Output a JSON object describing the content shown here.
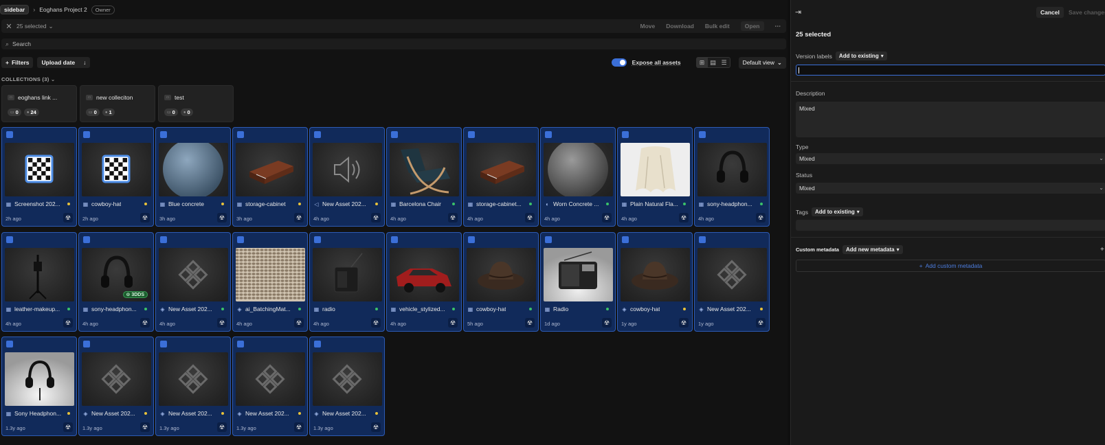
{
  "breadcrumb": {
    "sidebar_label": "sidebar",
    "project": "Eoghans Project 2",
    "role": "Owner"
  },
  "selection_bar": {
    "count": "25 selected",
    "actions": [
      "Move",
      "Download",
      "Bulk edit",
      "Open"
    ]
  },
  "search": {
    "placeholder": "Search"
  },
  "toolbar": {
    "filters": "Filters",
    "sort": "Upload date",
    "expose": "Expose all assets",
    "view": "Default view"
  },
  "collections": {
    "label": "COLLECTIONS (3)",
    "items": [
      {
        "name": "eoghans link ...",
        "a": "0",
        "b": "24"
      },
      {
        "name": "new colleciton",
        "a": "0",
        "b": "1"
      },
      {
        "name": "test",
        "a": "0",
        "b": "0"
      }
    ]
  },
  "assets": [
    {
      "name": "Screenshot 202...",
      "time": "2h ago",
      "dot": "#e8c23a",
      "thumb": "checker",
      "icon": "grid"
    },
    {
      "name": "cowboy-hat",
      "time": "2h ago",
      "dot": "#e8c23a",
      "thumb": "checker",
      "icon": "grid"
    },
    {
      "name": "Blue concrete",
      "time": "3h ago",
      "dot": "#e8c23a",
      "thumb": "sphere-blue",
      "icon": "grid"
    },
    {
      "name": "storage-cabinet",
      "time": "3h ago",
      "dot": "#e8c23a",
      "thumb": "cabinet",
      "icon": "grid"
    },
    {
      "name": "New Asset 202...",
      "time": "4h ago",
      "dot": "#e8c23a",
      "thumb": "speaker",
      "icon": "speaker"
    },
    {
      "name": "Barcelona Chair",
      "time": "4h ago",
      "dot": "#3ac26a",
      "thumb": "chair",
      "icon": "table"
    },
    {
      "name": "storage-cabinet...",
      "time": "4h ago",
      "dot": "#3ac26a",
      "thumb": "cabinet",
      "icon": "table"
    },
    {
      "name": "Worn Concrete ...",
      "time": "4h ago",
      "dot": "#3ac26a",
      "thumb": "sphere-grey",
      "icon": "globe"
    },
    {
      "name": "Plain Natural Fla...",
      "time": "4h ago",
      "dot": "#3ac26a",
      "thumb": "cloth",
      "icon": "grid"
    },
    {
      "name": "sony-headphon...",
      "time": "4h ago",
      "dot": "#3ac26a",
      "thumb": "headphones",
      "icon": "table"
    },
    {
      "name": "leather-makeup...",
      "time": "4h ago",
      "dot": "#3ac26a",
      "thumb": "stand",
      "icon": "table"
    },
    {
      "name": "sony-headphon...",
      "time": "4h ago",
      "dot": "#3ac26a",
      "thumb": "headphones",
      "icon": "table",
      "tag": "3DDS"
    },
    {
      "name": "New Asset 202...",
      "time": "4h ago",
      "dot": "#3ac26a",
      "thumb": "diamond",
      "icon": "diamond"
    },
    {
      "name": "ai_BatchingMat...",
      "time": "4h ago",
      "dot": "#3ac26a",
      "thumb": "fabric",
      "icon": "diamond"
    },
    {
      "name": "radio",
      "time": "4h ago",
      "dot": "#3ac26a",
      "thumb": "radio-dark",
      "icon": "table"
    },
    {
      "name": "vehicle_stylized...",
      "time": "4h ago",
      "dot": "#3ac26a",
      "thumb": "car",
      "icon": "table"
    },
    {
      "name": "cowboy-hat",
      "time": "5h ago",
      "dot": "#3ac26a",
      "thumb": "hat",
      "icon": "table"
    },
    {
      "name": "Radio",
      "time": "1d ago",
      "dot": "#3ac26a",
      "thumb": "radio-light",
      "icon": "table"
    },
    {
      "name": "cowboy-hat",
      "time": "1y ago",
      "dot": "#e8c23a",
      "thumb": "hat",
      "icon": "diamond"
    },
    {
      "name": "New Asset 202...",
      "time": "1y ago",
      "dot": "#e8c23a",
      "thumb": "diamond",
      "icon": "diamond"
    },
    {
      "name": "Sony Headphon...",
      "time": "1.3y ago",
      "dot": "#e8c23a",
      "thumb": "headphones-light",
      "icon": "table"
    },
    {
      "name": "New Asset 202...",
      "time": "1.3y ago",
      "dot": "#e8c23a",
      "thumb": "diamond",
      "icon": "diamond"
    },
    {
      "name": "New Asset 202...",
      "time": "1.3y ago",
      "dot": "#e8c23a",
      "thumb": "diamond",
      "icon": "diamond"
    },
    {
      "name": "New Asset 202...",
      "time": "1.3y ago",
      "dot": "#e8c23a",
      "thumb": "diamond",
      "icon": "diamond"
    },
    {
      "name": "New Asset 202...",
      "time": "1.3y ago",
      "dot": "#e8c23a",
      "thumb": "diamond",
      "icon": "diamond"
    }
  ],
  "panel": {
    "cancel": "Cancel",
    "save": "Save changes",
    "title": "25 selected",
    "version_labels": "Version labels",
    "version_mode": "Add to existing",
    "description_label": "Description",
    "description_value": "Mixed",
    "type_label": "Type",
    "type_value": "Mixed",
    "status_label": "Status",
    "status_value": "Mixed",
    "tags_label": "Tags",
    "tags_mode": "Add to existing",
    "custom_label": "Custom metadata",
    "custom_mode": "Add new metadata",
    "add_custom": "Add custom metadata"
  },
  "colors": {
    "accent": "#3b6fd8",
    "card_bg": "#112a5a",
    "card_border": "#2d5bb5"
  }
}
